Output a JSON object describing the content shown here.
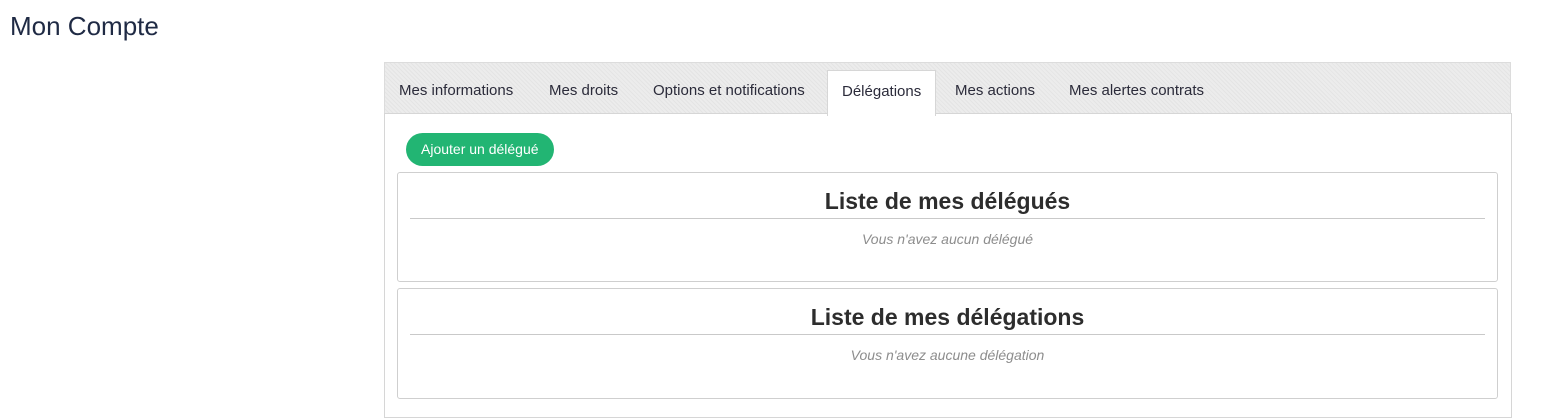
{
  "page": {
    "title": "Mon Compte"
  },
  "tabs": [
    {
      "label": "Mes informations",
      "active": false
    },
    {
      "label": "Mes droits",
      "active": false
    },
    {
      "label": "Options et notifications",
      "active": false
    },
    {
      "label": "Délégations",
      "active": true
    },
    {
      "label": "Mes actions",
      "active": false
    },
    {
      "label": "Mes alertes contrats",
      "active": false
    }
  ],
  "delegations_panel": {
    "add_button_label": "Ajouter un délégué",
    "delegates": {
      "title": "Liste de mes délégués",
      "empty_message": "Vous n'avez aucun délégué"
    },
    "delegations": {
      "title": "Liste de mes délégations",
      "empty_message": "Vous n'avez aucune délégation"
    }
  },
  "colors": {
    "accent_button": "#22b573",
    "title_text": "#1f2a44",
    "empty_text": "#8d8d8d"
  }
}
